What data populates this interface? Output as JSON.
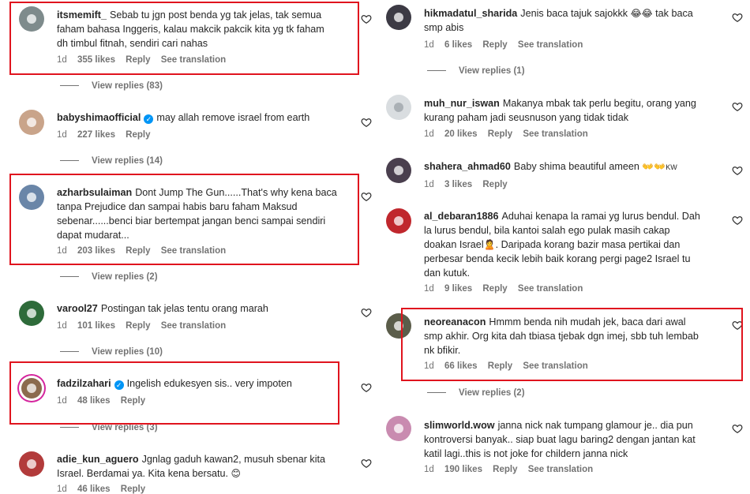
{
  "accent_colors": {
    "highlight": "#e0141e",
    "verified": "#0095f6",
    "meta_text": "#737373"
  },
  "left_column": [
    {
      "username": "itsmemift_",
      "verified": false,
      "text_lines": [
        "Sebab tu jgn post benda yg tak jelas, tak semua",
        "faham bahasa Inggeris, kalau makcik pakcik kita yg tk faham",
        "dh timbul fitnah, sendiri cari nahas"
      ],
      "time": "1d",
      "likes": "355 likes",
      "reply": "Reply",
      "translation": "See translation",
      "view_replies": "View replies (83)"
    },
    {
      "username": "babyshimaofficial",
      "verified": true,
      "text_lines": [
        "may allah remove israel from earth"
      ],
      "time": "1d",
      "likes": "227 likes",
      "reply": "Reply",
      "translation": "",
      "view_replies": "View replies (14)"
    },
    {
      "username": "azharbsulaiman",
      "verified": false,
      "text_lines": [
        "Dont Jump The Gun......That's why kena baca",
        "tanpa Prejudice dan sampai habis baru faham Maksud",
        "sebenar......benci biar bertempat jangan benci sampai sendiri",
        "dapat mudarat..."
      ],
      "time": "1d",
      "likes": "203 likes",
      "reply": "Reply",
      "translation": "See translation",
      "view_replies": "View replies (2)"
    },
    {
      "username": "varool27",
      "verified": false,
      "text_lines": [
        "Postingan tak jelas tentu orang marah"
      ],
      "time": "1d",
      "likes": "101 likes",
      "reply": "Reply",
      "translation": "See translation",
      "view_replies": "View replies (10)"
    },
    {
      "username": "fadzilzahari",
      "verified": true,
      "text_lines": [
        "Ingelish edukesyen sis.. very impoten"
      ],
      "time": "1d",
      "likes": "48 likes",
      "reply": "Reply",
      "translation": "",
      "view_replies": "View replies (3)"
    },
    {
      "username": "adie_kun_aguero",
      "verified": false,
      "text_lines": [
        "Jgnlag gaduh kawan2, musuh sbenar kita",
        "Israel. Berdamai ya. Kita kena bersatu."
      ],
      "emoji_end": "😊",
      "time": "1d",
      "likes": "46 likes",
      "reply": "Reply",
      "translation": "",
      "view_replies": ""
    }
  ],
  "right_column": [
    {
      "username": "hikmadatul_sharida",
      "verified": false,
      "text_lines": [
        "Jenis baca tajuk sajokkk",
        "smp abis"
      ],
      "emoji_mid": "😂😂",
      "text_after_emoji": "tak baca",
      "time": "1d",
      "likes": "6 likes",
      "reply": "Reply",
      "translation": "See translation",
      "view_replies": "View replies (1)"
    },
    {
      "username": "muh_nur_iswan",
      "verified": false,
      "text_lines": [
        "Makanya mbak tak perlu begitu, orang yang",
        "kurang paham jadi seusnuson yang tidak tidak"
      ],
      "time": "1d",
      "likes": "20 likes",
      "reply": "Reply",
      "translation": "See translation",
      "view_replies": ""
    },
    {
      "username": "shahera_ahmad60",
      "verified": false,
      "text_lines": [
        "Baby shima beautiful ameen"
      ],
      "emoji_end": "👐👐",
      "suffix": "KW",
      "time": "1d",
      "likes": "3 likes",
      "reply": "Reply",
      "translation": "",
      "view_replies": ""
    },
    {
      "username": "al_debaran1886",
      "verified": false,
      "text_lines": [
        "Aduhai kenapa la ramai yg lurus bendul. Dah",
        "la lurus bendul, bila kantoi salah ego pulak masih cakap",
        "doakan Israel",
        ". Daripada korang bazir masa pertikai dan",
        "perbesar benda kecik lebih baik korang pergi page2 Israel tu",
        "dan kutuk."
      ],
      "emoji_mid": "🙎",
      "time": "1d",
      "likes": "9 likes",
      "reply": "Reply",
      "translation": "See translation",
      "view_replies": ""
    },
    {
      "username": "neoreanacon",
      "verified": false,
      "text_lines": [
        "Hmmm benda nih mudah jek, baca dari awal",
        "smp akhir. Org kita dah tbiasa tjebak dgn imej, sbb tuh lembab",
        "nk bfikir."
      ],
      "time": "1d",
      "likes": "66 likes",
      "reply": "Reply",
      "translation": "See translation",
      "view_replies": "View replies (2)"
    },
    {
      "username": "slimworld.wow",
      "verified": false,
      "text_lines": [
        "janna nick nak tumpang glamour je.. dia pun",
        "kontroversi banyak.. siap buat lagu baring2 dengan jantan kat",
        "katil lagi..this is not joke for childern janna nick"
      ],
      "time": "1d",
      "likes": "190 likes",
      "reply": "Reply",
      "translation": "See translation",
      "view_replies": ""
    }
  ]
}
